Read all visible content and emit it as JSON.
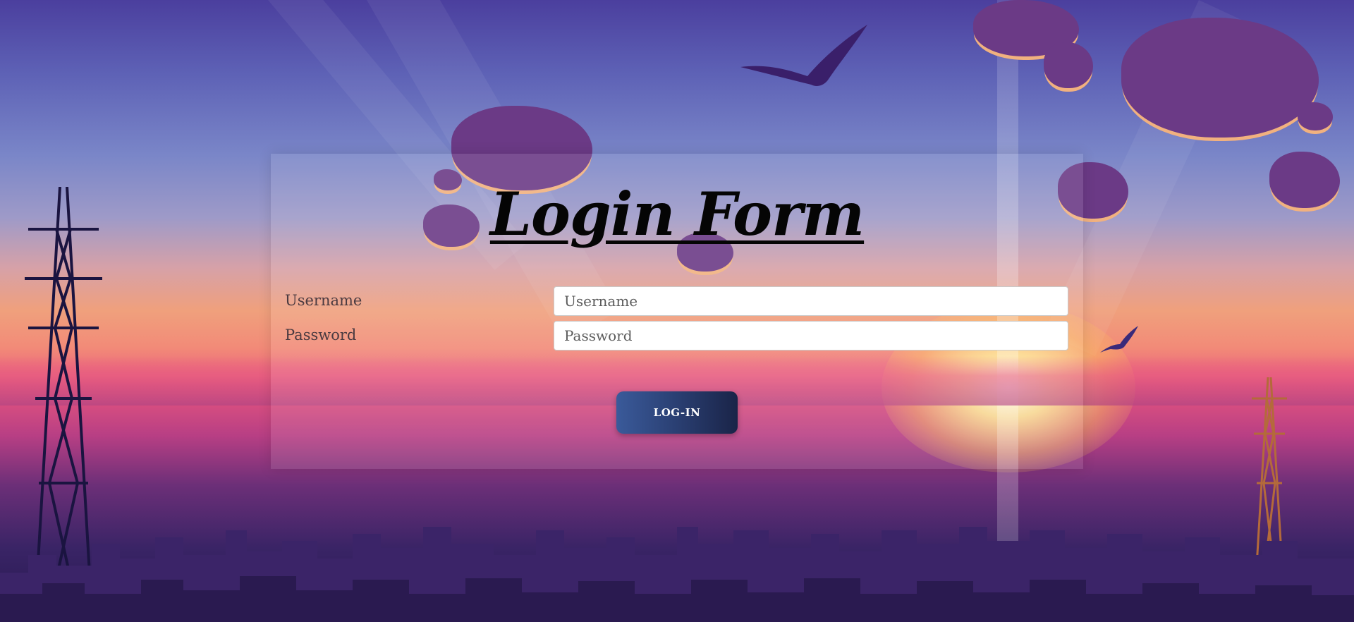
{
  "login_form": {
    "title": "Login Form",
    "username_label": "Username",
    "username_placeholder": "Username",
    "username_value": "",
    "password_label": "Password",
    "password_placeholder": "Password",
    "password_value": "",
    "login_button_label": "LOG-IN"
  },
  "background": {
    "scene": "sunset-city-skyline",
    "colors": {
      "sky_top": "#4b3f9e",
      "sky_mid": "#f0a07c",
      "horizon": "#e8567e",
      "ground": "#25184f"
    }
  },
  "button_colors": {
    "start": "#3a5a9a",
    "end": "#1a2448"
  }
}
